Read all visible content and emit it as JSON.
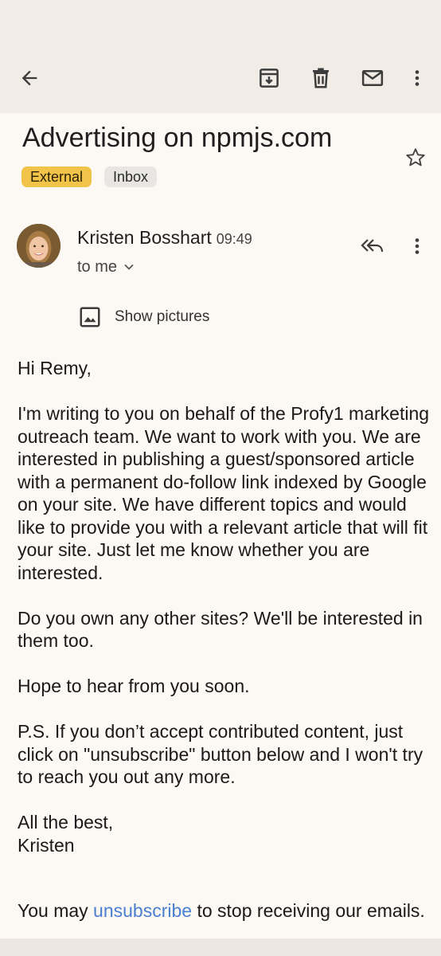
{
  "toolbar": {
    "back": "back-arrow-icon",
    "archive": "archive-icon",
    "delete": "trash-icon",
    "mark_unread": "mail-icon",
    "more": "more-vert-icon"
  },
  "email": {
    "subject": "Advertising on npmjs.com",
    "labels": [
      "External",
      "Inbox"
    ],
    "sender": "Kristen Bosshart",
    "time": "09:49",
    "recipient": "to me",
    "show_pictures": "Show pictures",
    "body": [
      "Hi Remy,",
      "I'm writing to you on behalf of the Profy1 marketing outreach team. We want to work with you. We are interested in publishing a guest/sponsored article with a permanent do-follow link indexed by Google on your site. We have different topics and would like to provide you with a relevant article that will fit your site. Just let me know whether you are interested.",
      "Do you own any other sites? We'll be interested in them too.",
      "Hope to hear from you soon.",
      "P.S. If you don’t accept contributed content, just click on \"unsubscribe\" button below and I won't try to reach you out any more.",
      "All the best,\nKristen"
    ],
    "footer_prefix": "You may ",
    "footer_link": "unsubscribe",
    "footer_suffix": " to stop receiving our emails."
  },
  "colors": {
    "background": "#fcf8f3",
    "toolbar": "#f1ede6",
    "external_chip": "#f2c349",
    "inbox_chip": "#e8e6e3",
    "link": "#4a7fd0"
  }
}
